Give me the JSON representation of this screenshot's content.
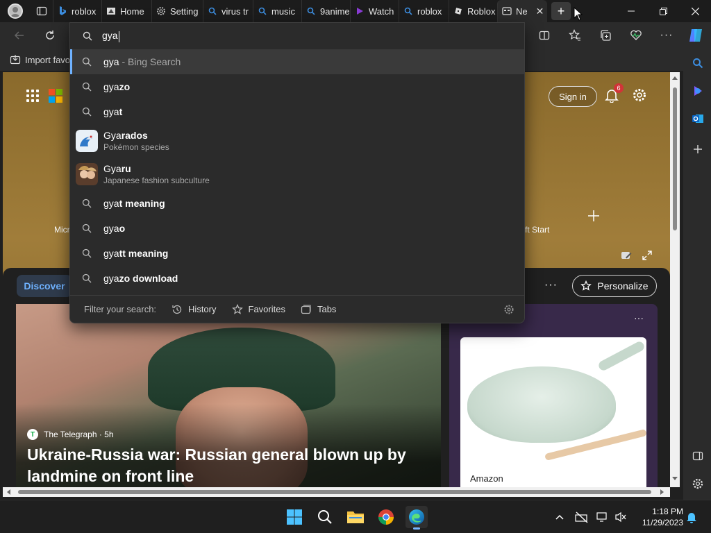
{
  "browser": {
    "tabs": [
      {
        "icon": "bing-icon",
        "label": "roblox"
      },
      {
        "icon": "page-icon",
        "label": "Home"
      },
      {
        "icon": "gear-icon",
        "label": "Setting"
      },
      {
        "icon": "search-icon",
        "label": "virus tr"
      },
      {
        "icon": "search-icon",
        "label": "music"
      },
      {
        "icon": "search-icon",
        "label": "9anime"
      },
      {
        "icon": "play-icon",
        "label": "Watch"
      },
      {
        "icon": "search-icon",
        "label": "roblox"
      },
      {
        "icon": "roblox-icon",
        "label": "Roblox"
      },
      {
        "icon": "newtab-icon",
        "label": "Ne",
        "active": true
      }
    ],
    "new_tab_symbol": "+",
    "favorites_bar": {
      "import_label": "Import favo"
    }
  },
  "omnibox": {
    "typed": "gya",
    "suggestions": [
      {
        "kind": "search",
        "typed": "gya",
        "rest": "",
        "hint": " - Bing Search",
        "selected": true
      },
      {
        "kind": "search",
        "typed": "gya",
        "rest": "zo"
      },
      {
        "kind": "search",
        "typed": "gya",
        "rest": "t"
      },
      {
        "kind": "entity",
        "typed": "Gya",
        "rest": "rados",
        "sub": "Pokémon species"
      },
      {
        "kind": "entity",
        "typed": "Gya",
        "rest": "ru",
        "sub": "Japanese fashion subculture"
      },
      {
        "kind": "search",
        "typed": "gya",
        "rest": "t meaning"
      },
      {
        "kind": "search",
        "typed": "gya",
        "rest": "o"
      },
      {
        "kind": "search",
        "typed": "gya",
        "rest": "tt meaning"
      },
      {
        "kind": "search",
        "typed": "gya",
        "rest": "zo download"
      }
    ],
    "filter": {
      "label": "Filter your search:",
      "history": "History",
      "favorites": "Favorites",
      "tabs": "Tabs"
    }
  },
  "newtab": {
    "sign_in": "Sign in",
    "notification_count": "6",
    "quicklink_left": "Micr",
    "quicklink_right": "ft Start",
    "discover": "Discover",
    "personalize": "Personalize",
    "news": {
      "source": "The Telegraph · 5h",
      "headline": "Ukraine-Russia war: Russian general blown up by landmine on front line"
    },
    "ad": {
      "label": "Amazon"
    }
  },
  "taskbar": {
    "time": "1:18 PM",
    "date": "11/29/2023"
  },
  "colors": {
    "accent": "#6fb2ff",
    "badge": "#d13438",
    "dropdown_bg": "#2b2b2b"
  }
}
